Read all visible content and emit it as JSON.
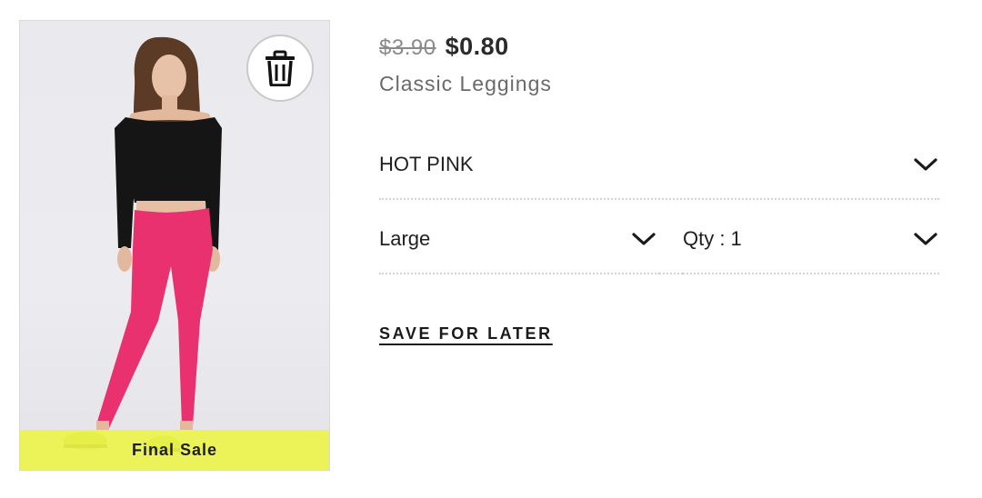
{
  "product": {
    "image_alt": "Woman wearing black off-shoulder top and hot pink leggings",
    "badge": "Final Sale",
    "old_price": "$3.90",
    "new_price": "$0.80",
    "name": "Classic Leggings"
  },
  "options": {
    "color": "HOT PINK",
    "size": "Large",
    "quantity": "Qty : 1"
  },
  "actions": {
    "save_for_later": "SAVE FOR LATER",
    "delete_icon": "trash-icon",
    "dropdown_icon": "chevron-down-icon"
  },
  "colors": {
    "badge_background": "#ecf44c",
    "leggings": "#e8316e",
    "top": "#1a1a1a",
    "divider": "#d4d4d4"
  }
}
